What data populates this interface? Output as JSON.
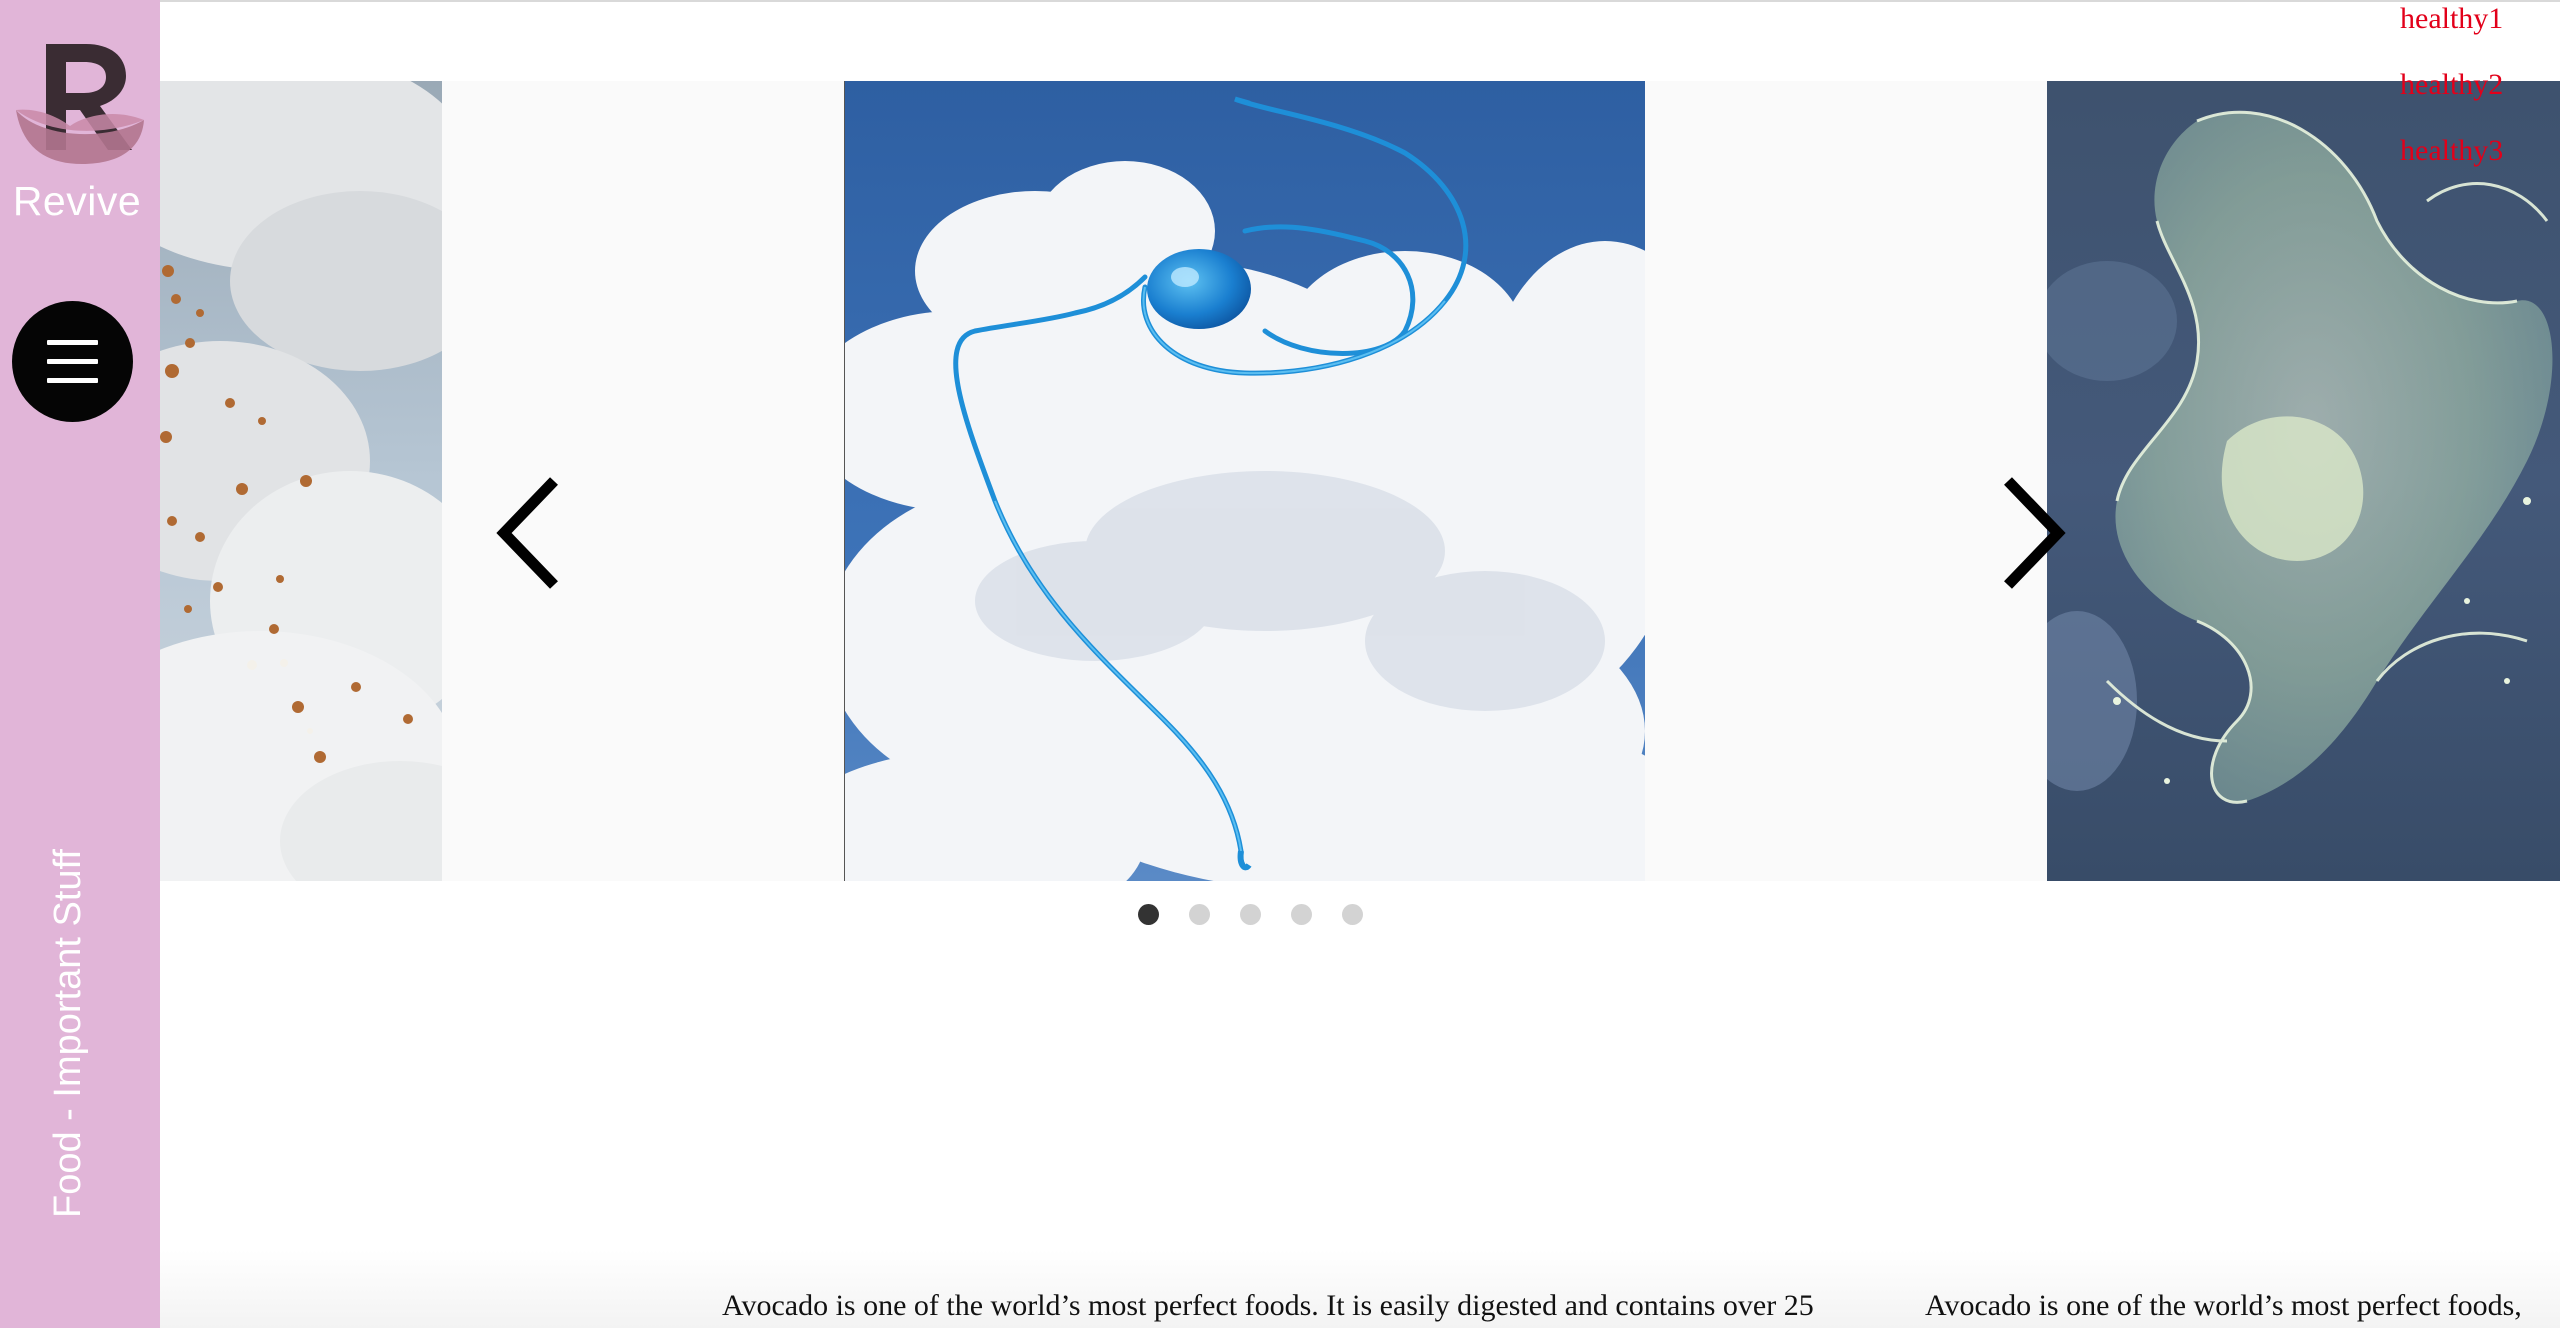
{
  "sidebar": {
    "brand_name": "Revive",
    "vertical_label": "Food - Important Stuff",
    "menu_icon": "hamburger-menu-icon",
    "background_color": "#e1b5d8"
  },
  "top_links": [
    {
      "label": "healthy1"
    },
    {
      "label": "healthy2"
    },
    {
      "label": "healthy3"
    }
  ],
  "slider": {
    "slides": [
      {
        "subject": "food pieces falling against cloudy sky"
      },
      {
        "subject": "blue liquid splash against blue sky with clouds"
      },
      {
        "subject": "translucent green liquid splash against dark blue sky"
      }
    ],
    "prev_icon": "chevron-left-icon",
    "next_icon": "chevron-right-icon",
    "dot_count": 5,
    "active_dot": 1
  },
  "articles": [
    {
      "snippet": "Avocado is one of the world’s most perfect foods. It is easily digested and contains over 25"
    },
    {
      "snippet": "Avocado is one of the world’s most perfect foods,"
    }
  ],
  "colors": {
    "accent_red": "#e2001a",
    "sidebar_pink": "#e1b5d8",
    "menu_black": "#050505"
  }
}
